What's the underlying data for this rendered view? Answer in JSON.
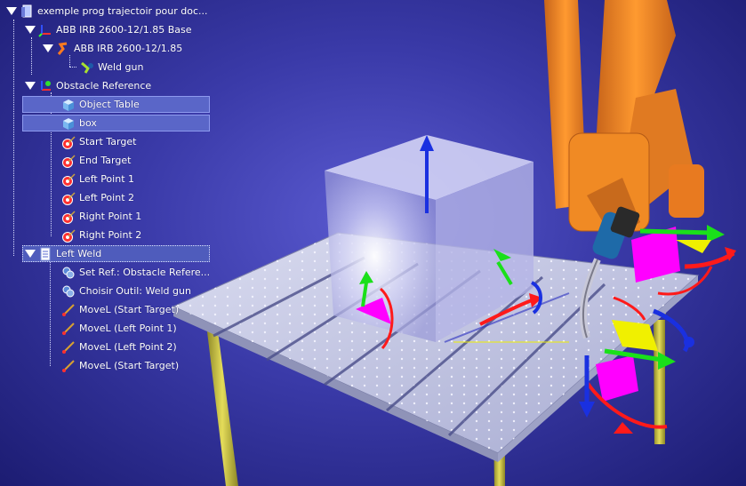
{
  "tree": {
    "root_label": "exemple prog trajectoir pour doc...",
    "base_label": "ABB IRB 2600-12/1.85 Base",
    "robot_label": "ABB IRB 2600-12/1.85",
    "tool_label": "Weld gun",
    "obstacle_label": "Obstacle Reference",
    "obstacle_items": [
      {
        "label": "Object Table",
        "icon": "cube-icon"
      },
      {
        "label": "box",
        "icon": "cube-icon"
      },
      {
        "label": "Start Target",
        "icon": "target-icon"
      },
      {
        "label": "End Target",
        "icon": "target-icon"
      },
      {
        "label": "Left Point 1",
        "icon": "target-icon"
      },
      {
        "label": "Left Point 2",
        "icon": "target-icon"
      },
      {
        "label": "Right Point 1",
        "icon": "target-icon"
      },
      {
        "label": "Right Point 2",
        "icon": "target-icon"
      }
    ],
    "program_label": "Left Weld",
    "program_items": [
      {
        "label": "Set Ref.: Obstacle Refere...",
        "icon": "set-reference-icon"
      },
      {
        "label": "Choisir Outil: Weld gun",
        "icon": "choose-tool-icon"
      },
      {
        "label": "MoveL (Start Target)",
        "icon": "movel-icon"
      },
      {
        "label": "MoveL (Left Point 1)",
        "icon": "movel-icon"
      },
      {
        "label": "MoveL (Left Point 2)",
        "icon": "movel-icon"
      },
      {
        "label": "MoveL (Start Target)",
        "icon": "movel-icon"
      }
    ]
  },
  "colors": {
    "background": "#3a3aa8",
    "robot": "#f08a24",
    "table": "#c8cce0",
    "table_legs": "#c8c040",
    "box": "#c8c8f0",
    "axis_x": "#ff1a1a",
    "axis_y": "#1ae01a",
    "axis_z": "#1a40ff",
    "gizmo_magenta": "#ff00ff",
    "gizmo_yellow": "#f0f000",
    "selection": "#5a66c8"
  }
}
